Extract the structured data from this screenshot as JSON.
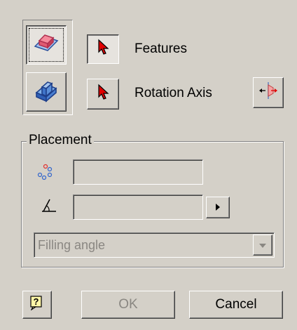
{
  "selection": {
    "features_label": "Features",
    "rotation_axis_label": "Rotation Axis"
  },
  "placement": {
    "group_label": "Placement",
    "count_value": "",
    "angle_value": "",
    "mode_select_value": "Filling angle"
  },
  "footer": {
    "ok_label": "OK",
    "cancel_label": "Cancel",
    "help_glyph": "?"
  },
  "icons": {
    "solid_mode": "solid-extrude-icon",
    "surface_mode": "surface-extrude-icon",
    "features_select": "select-arrow-icon",
    "axis_select": "select-arrow-icon",
    "flip": "flip-direction-icon",
    "count": "pattern-count-icon",
    "angle": "angle-icon",
    "expand": "arrow-right-icon",
    "dropdown": "chevron-down-icon",
    "help": "help-icon"
  },
  "colors": {
    "dialog_bg": "#d4d0c8",
    "selector_red": "#e00000",
    "icon_blue": "#3366cc",
    "icon_pink": "#f08080",
    "disabled_text": "#8a8782"
  }
}
